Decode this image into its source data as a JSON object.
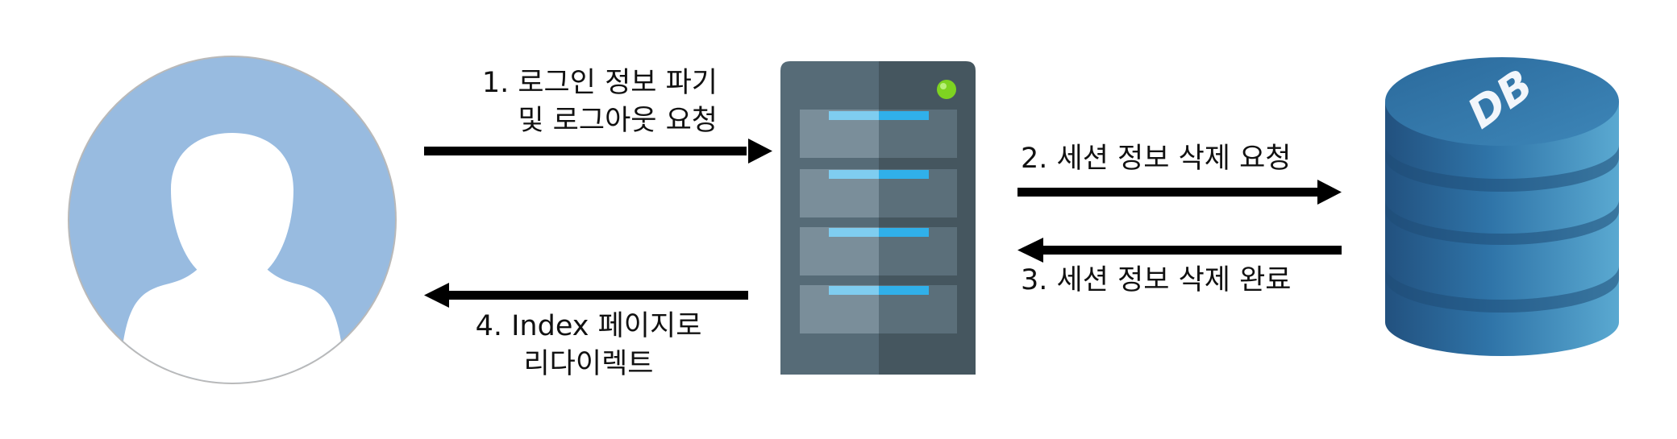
{
  "diagram": {
    "step1": {
      "line1": "1. 로그인 정보 파기",
      "line2": "및 로그아웃 요청"
    },
    "step2": {
      "text": "2. 세션 정보 삭제 요청"
    },
    "step3": {
      "text": "3. 세션 정보 삭제 완료"
    },
    "step4": {
      "line1": "4. Index 페이지로",
      "line2": "리다이렉트"
    },
    "db_label": "DB",
    "colors": {
      "user_fill": "#98bbe0",
      "server_dark": "#45565f",
      "server_light": "#546a75",
      "server_led": "#7ed321",
      "db_blue": "#2e6fa3",
      "db_light": "#5aa7cf",
      "arrow": "#000000"
    }
  }
}
